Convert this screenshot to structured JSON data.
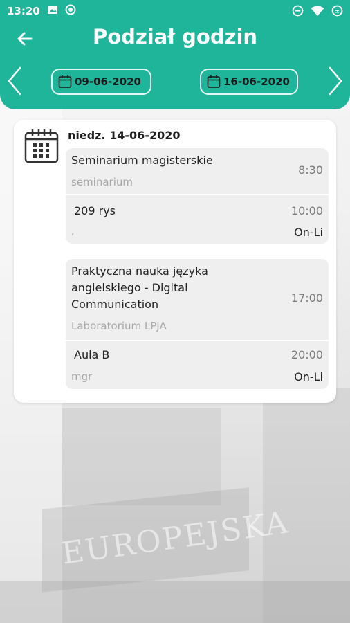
{
  "status_bar": {
    "time": "13:20",
    "icons_left": [
      "image-icon",
      "record-icon"
    ],
    "icons_right": [
      "dnd-icon",
      "wifi-icon",
      "battery-saver-icon"
    ]
  },
  "header": {
    "title": "Podział godzin",
    "date_from": "09-06-2020",
    "date_to": "16-06-2020"
  },
  "day": {
    "label": "niedz. 14-06-2020",
    "lessons": [
      {
        "name": "Seminarium magisterskie",
        "type": "seminarium",
        "start": "8:30",
        "room": "209 rys",
        "end": "10:00",
        "teacher": ",",
        "mode": "On-Li"
      },
      {
        "name_lines": [
          "Praktyczna nauka języka",
          "angielskiego - Digital",
          "Communication"
        ],
        "type": "Laboratorium LPJA",
        "start": "17:00",
        "room": "Aula B",
        "end": "20:00",
        "teacher": "mgr",
        "mode": "On-Li"
      }
    ]
  },
  "colors": {
    "accent": "#1fb59a",
    "card": "#ffffff",
    "lesson_bg": "#efefef",
    "muted_text": "#a8a8a8"
  }
}
